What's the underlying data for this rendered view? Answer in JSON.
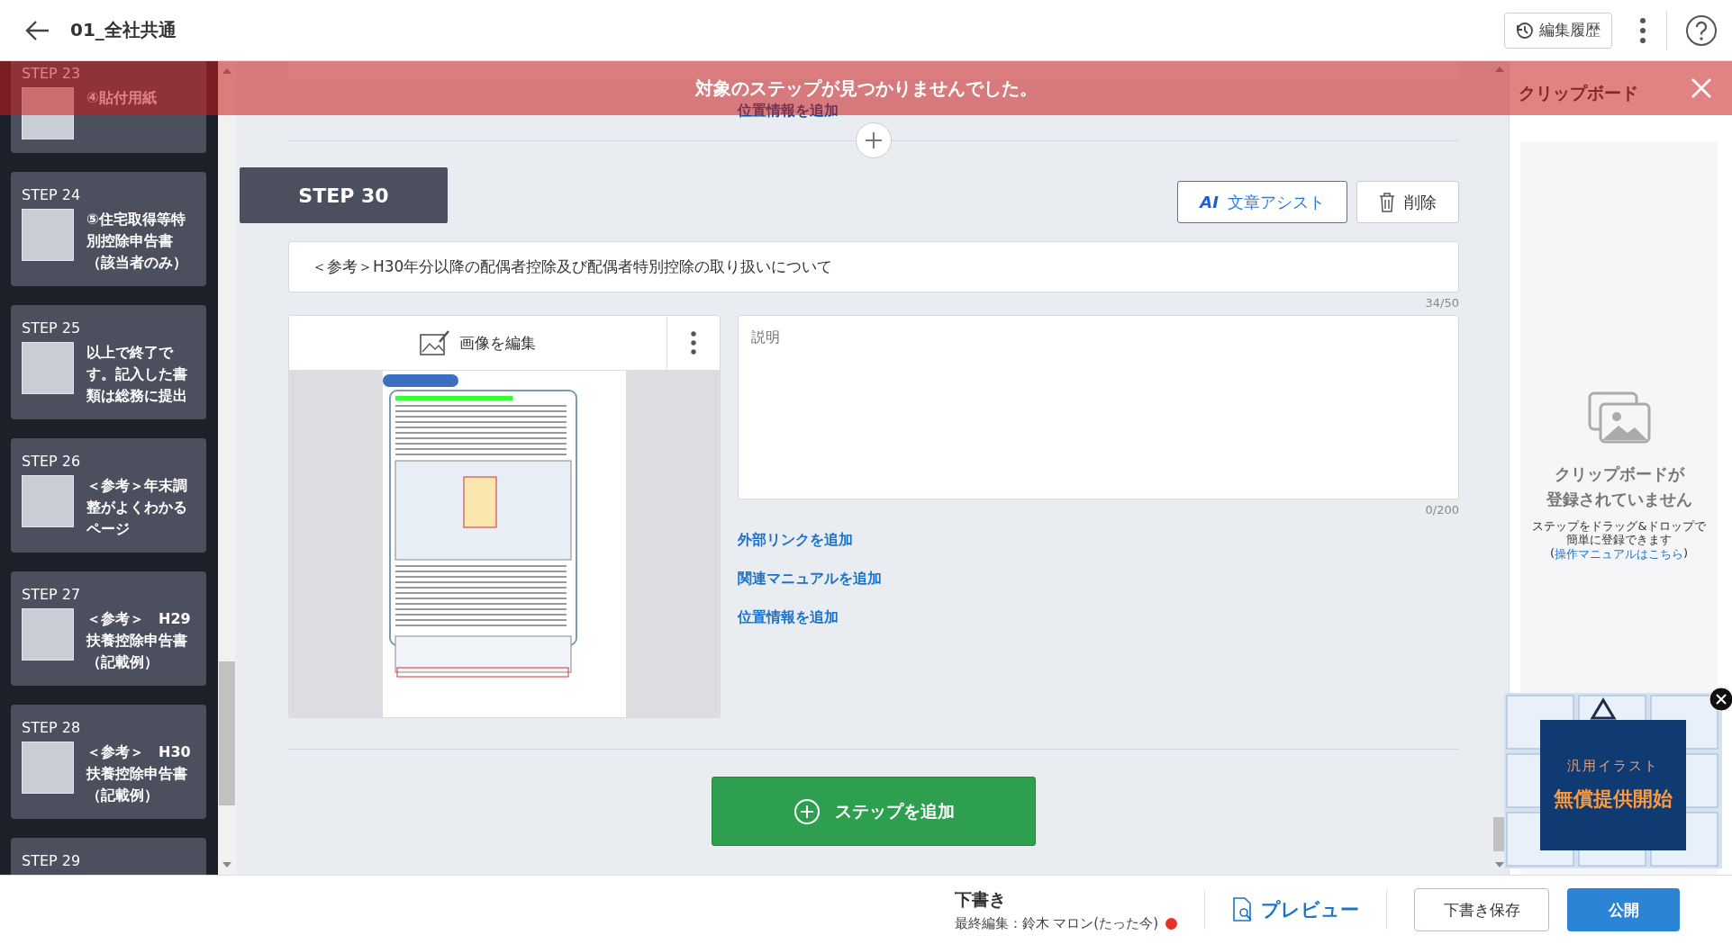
{
  "header": {
    "title": "01_全社共通",
    "history_button": "編集履歴"
  },
  "banner": {
    "message": "対象のステップが見つかりませんでした。"
  },
  "sidebar": {
    "steps": [
      {
        "label": "STEP 23",
        "title": "④貼付用紙"
      },
      {
        "label": "STEP 24",
        "title": "⑤住宅取得等特別控除申告書（該当者のみ）"
      },
      {
        "label": "STEP 25",
        "title": "以上で終了です。記入した書類は総務に提出"
      },
      {
        "label": "STEP 26",
        "title": "＜参考＞年末調整がよくわかるページ"
      },
      {
        "label": "STEP 27",
        "title": "＜参考＞　H29扶養控除申告書（記載例）"
      },
      {
        "label": "STEP 28",
        "title": "＜参考＞　H30扶養控除申告書（記載例）"
      },
      {
        "label": "STEP 29"
      }
    ]
  },
  "main": {
    "top_link": "位置情報を追加",
    "step": {
      "label": "STEP 30",
      "ai_mark": "AI",
      "assist_button": "文章アシスト",
      "delete_button": "削除",
      "title_value": "＜参考＞H30年分以降の配偶者控除及び配偶者特別控除の取り扱いについて",
      "title_counter": "34/50",
      "image_edit": "画像を編集",
      "description_placeholder": "説明",
      "description_counter": "0/200",
      "links": [
        "外部リンクを追加",
        "関連マニュアルを追加",
        "位置情報を追加"
      ]
    },
    "add_step_button": "ステップを追加"
  },
  "clipboard": {
    "title": "クリップボード",
    "empty_title_lines": [
      "クリップボードが",
      "登録されていません"
    ],
    "help_lines": [
      "ステップをドラッグ&ドロップで",
      "簡単に登録できます"
    ],
    "help_link_open": "(",
    "help_link": "操作マニュアルはこちら",
    "help_link_close": ")"
  },
  "ad": {
    "subtitle": "汎用イラスト",
    "headline": "無償提供開始"
  },
  "footer": {
    "status": "下書き",
    "last_edit": "最終編集：鈴木 マロン(たった今)",
    "unsaved_indicator": true,
    "preview": "プレビュー",
    "save_draft": "下書き保存",
    "publish": "公開"
  }
}
